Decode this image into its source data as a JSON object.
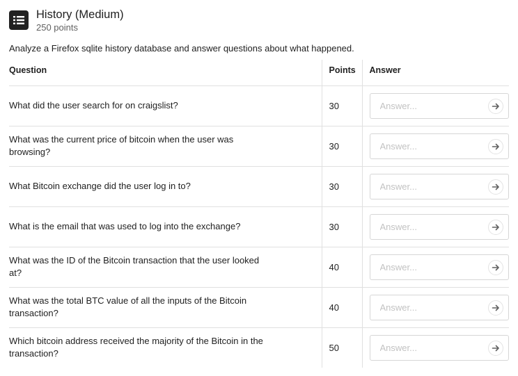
{
  "challenge": {
    "title": "History (Medium)",
    "points_label": "250 points",
    "icon": "list-icon",
    "description": "Analyze a Firefox sqlite history database and answer questions about what happened."
  },
  "table": {
    "headers": {
      "question": "Question",
      "points": "Points",
      "answer": "Answer"
    },
    "answer_placeholder": "Answer...",
    "submit_icon": "arrow-right-icon",
    "rows": [
      {
        "question": "What did the user search for on craigslist?",
        "points": "30",
        "answer": ""
      },
      {
        "question": "What was the current price of bitcoin when the user was browsing?",
        "points": "30",
        "answer": ""
      },
      {
        "question": "What Bitcoin exchange did the user log in to?",
        "points": "30",
        "answer": ""
      },
      {
        "question": "What is the email that was used to log into the exchange?",
        "points": "30",
        "answer": ""
      },
      {
        "question": "What was the ID of the Bitcoin transaction that the user looked at?",
        "points": "40",
        "answer": ""
      },
      {
        "question": "What was the total BTC value of all the inputs of the Bitcoin transaction?",
        "points": "40",
        "answer": ""
      },
      {
        "question": "Which bitcoin address received the majority of the Bitcoin in the transaction?",
        "points": "50",
        "answer": ""
      }
    ]
  }
}
